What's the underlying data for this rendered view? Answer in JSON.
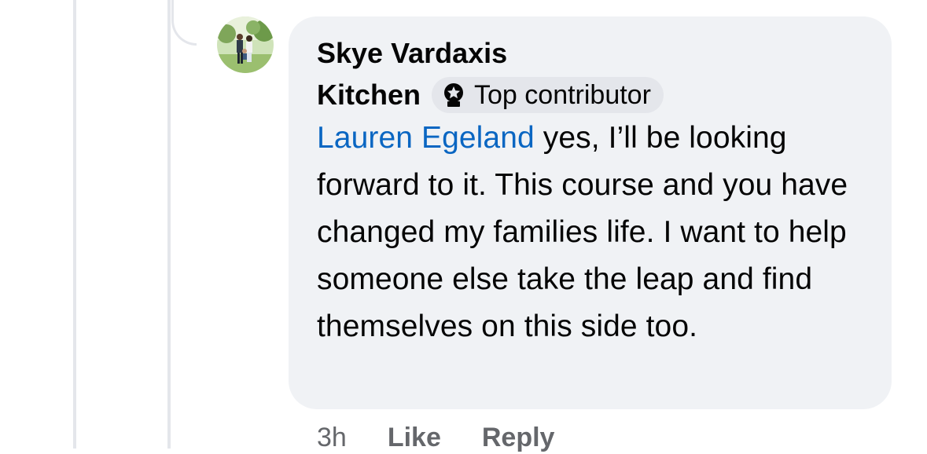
{
  "comment": {
    "author": {
      "name": "Skye Vardaxis",
      "affiliation": "Kitchen",
      "badge_label": "Top contributor",
      "badge_icon": "top-contributor-icon",
      "avatar": "family-photo-avatar"
    },
    "mention": "Lauren Egeland",
    "text": " yes, I’ll be looking forward to it. This course and you have changed my families life. I want to help someone else take the leap and find themselves on this side too."
  },
  "actions": {
    "time": "3h",
    "like_label": "Like",
    "reply_label": "Reply"
  },
  "colors": {
    "bubble_bg": "#f0f2f5",
    "badge_bg": "#e4e6eb",
    "mention": "#0a66c2",
    "meta_text": "#65676b",
    "thread_line": "#e4e6eb"
  }
}
